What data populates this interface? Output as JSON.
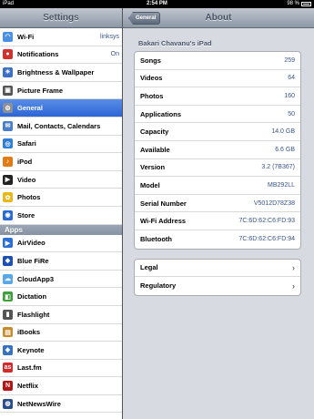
{
  "status": {
    "carrier": "iPad",
    "time": "2:54 PM",
    "battery": "98 %"
  },
  "left": {
    "title": "Settings",
    "items": [
      {
        "label": "Wi-Fi",
        "value": "linksys",
        "color": "#4a90e2",
        "glyph": "◠"
      },
      {
        "label": "Notifications",
        "value": "On",
        "color": "#d0312d",
        "glyph": "●"
      },
      {
        "label": "Brightness & Wallpaper",
        "value": "",
        "color": "#3a6fc4",
        "glyph": "☀"
      },
      {
        "label": "Picture Frame",
        "value": "",
        "color": "#555555",
        "glyph": "▣"
      },
      {
        "label": "General",
        "value": "",
        "color": "#8b8f96",
        "glyph": "⚙"
      },
      {
        "label": "Mail, Contacts, Calendars",
        "value": "",
        "color": "#4a7ec9",
        "glyph": "✉"
      },
      {
        "label": "Safari",
        "value": "",
        "color": "#2e7dd6",
        "glyph": "◎"
      },
      {
        "label": "iPod",
        "value": "",
        "color": "#e07b16",
        "glyph": "♪"
      },
      {
        "label": "Video",
        "value": "",
        "color": "#222222",
        "glyph": "▶"
      },
      {
        "label": "Photos",
        "value": "",
        "color": "#e9b818",
        "glyph": "✿"
      },
      {
        "label": "Store",
        "value": "",
        "color": "#2a6bd1",
        "glyph": "◉"
      }
    ],
    "apps_header": "Apps",
    "apps": [
      {
        "label": "AirVideo",
        "color": "#2d6fd0",
        "glyph": "▶"
      },
      {
        "label": "Blue FiRe",
        "color": "#1c4fb2",
        "glyph": "◆"
      },
      {
        "label": "CloudApp3",
        "color": "#58a8e8",
        "glyph": "☁"
      },
      {
        "label": "Dictation",
        "color": "#3f9f3f",
        "glyph": "◧"
      },
      {
        "label": "Flashlight",
        "color": "#555555",
        "glyph": "▮"
      },
      {
        "label": "iBooks",
        "color": "#c78a2c",
        "glyph": "▤"
      },
      {
        "label": "Keynote",
        "color": "#3a70c0",
        "glyph": "◈"
      },
      {
        "label": "Last.fm",
        "color": "#d22b2b",
        "glyph": "as"
      },
      {
        "label": "Netflix",
        "color": "#b11515",
        "glyph": "N"
      },
      {
        "label": "NetNewsWire",
        "color": "#2a4e8c",
        "glyph": "◍"
      }
    ]
  },
  "right": {
    "title": "About",
    "back_label": "General",
    "device_name": "Bakari Chavanu's iPad",
    "info": [
      {
        "key": "Songs",
        "value": "259"
      },
      {
        "key": "Videos",
        "value": "64"
      },
      {
        "key": "Photos",
        "value": "160"
      },
      {
        "key": "Applications",
        "value": "50"
      },
      {
        "key": "Capacity",
        "value": "14.0 GB"
      },
      {
        "key": "Available",
        "value": "6.6 GB"
      },
      {
        "key": "Version",
        "value": "3.2 (7B367)"
      },
      {
        "key": "Model",
        "value": "MB292LL"
      },
      {
        "key": "Serial Number",
        "value": "V5012D78Z38"
      },
      {
        "key": "Wi-Fi Address",
        "value": "7C:6D:62:C6:FD:93"
      },
      {
        "key": "Bluetooth",
        "value": "7C:6D:62:C6:FD:94"
      }
    ],
    "links": [
      {
        "label": "Legal"
      },
      {
        "label": "Regulatory"
      }
    ]
  }
}
